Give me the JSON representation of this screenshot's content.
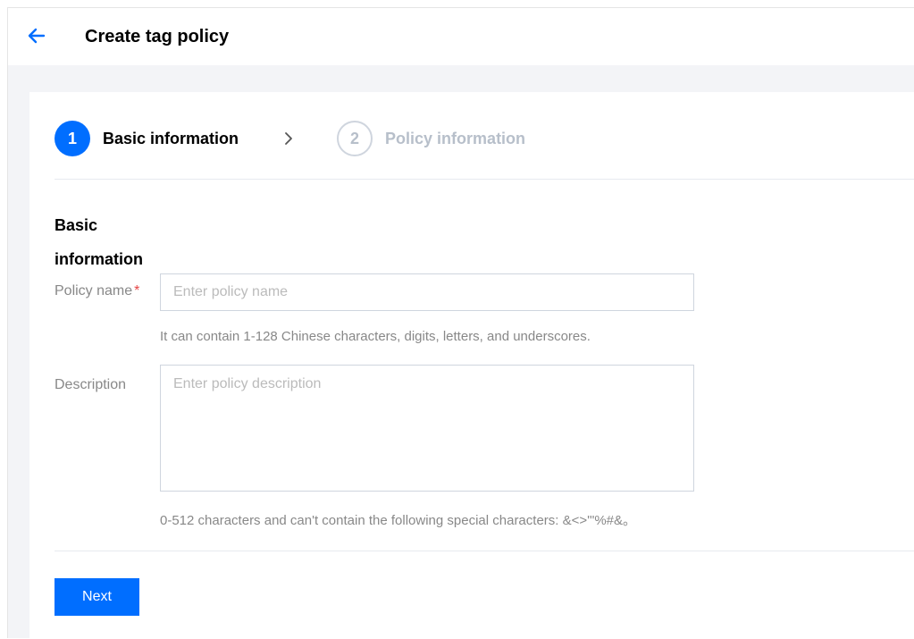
{
  "header": {
    "back_icon": "arrow-left-icon",
    "title": "Create tag policy"
  },
  "steps": [
    {
      "number": "1",
      "label": "Basic information",
      "state": "active"
    },
    {
      "number": "2",
      "label": "Policy information",
      "state": "inactive"
    }
  ],
  "form": {
    "section_title": "Basic information",
    "policy_name": {
      "label": "Policy name",
      "required_mark": "*",
      "value": "",
      "placeholder": "Enter policy name",
      "hint": "It can contain 1-128 Chinese characters, digits, letters, and underscores."
    },
    "description": {
      "label": "Description",
      "value": "",
      "placeholder": "Enter policy description",
      "hint": "0-512 characters and can't contain the following special characters: &<>'\"%#&。"
    },
    "next_label": "Next"
  },
  "colors": {
    "accent": "#006eff",
    "required": "#e54545",
    "muted_text": "#888888",
    "inactive_step": "#b7bfca"
  }
}
